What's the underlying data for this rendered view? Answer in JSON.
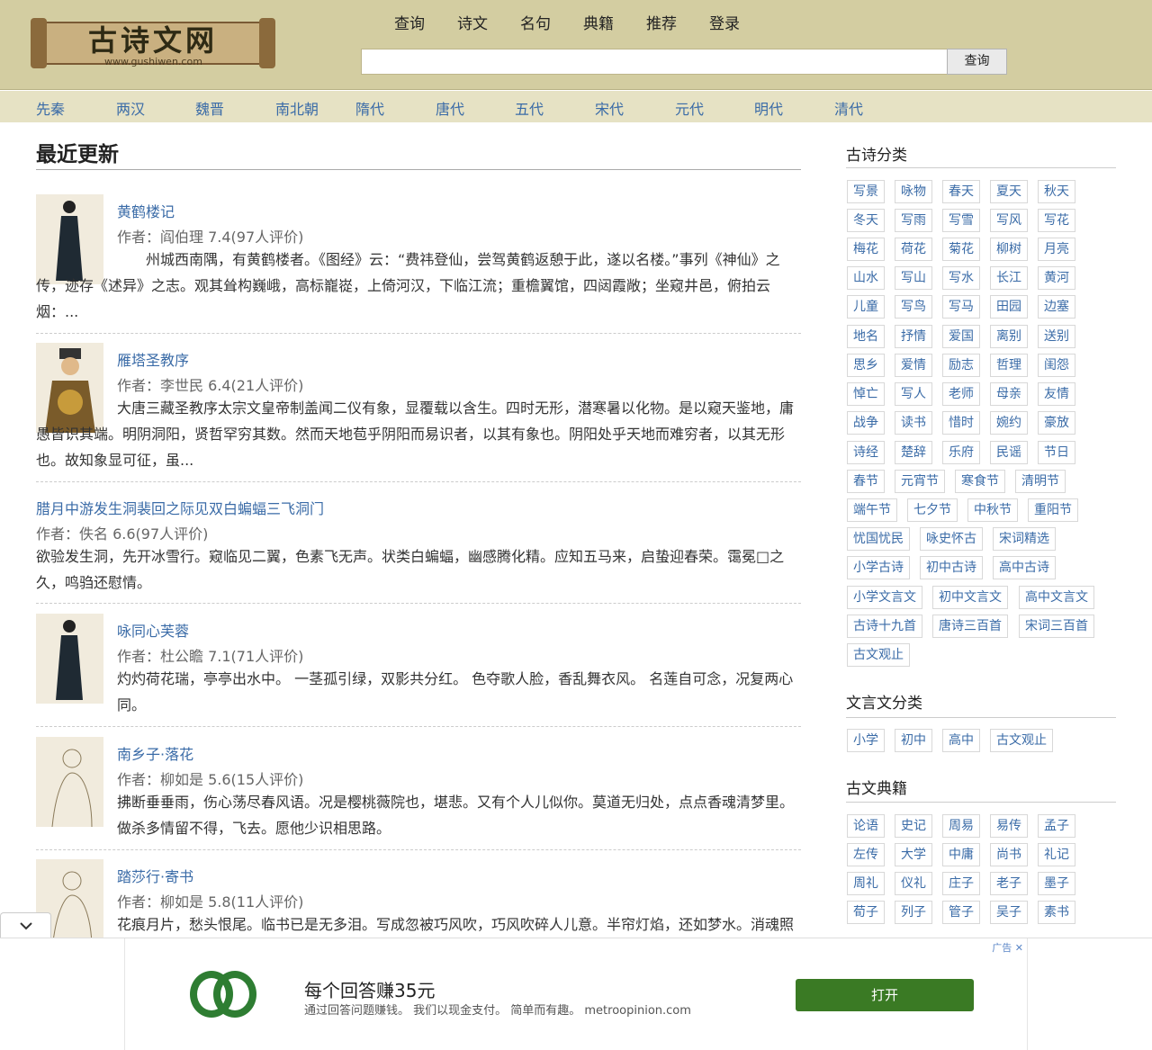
{
  "site": {
    "logo_text": "古诗文网",
    "logo_url_text": "www.gushiwen.com"
  },
  "nav": [
    "查询",
    "诗文",
    "名句",
    "典籍",
    "推荐",
    "登录"
  ],
  "search": {
    "placeholder": "",
    "button": "查询"
  },
  "dynasties": [
    "先秦",
    "两汉",
    "魏晋",
    "南北朝",
    "隋代",
    "唐代",
    "五代",
    "宋代",
    "元代",
    "明代",
    "清代"
  ],
  "main": {
    "title": "最近更新",
    "poems": [
      {
        "title": "黄鹤楼记",
        "author": "作者：阎伯理 7.4(97人评价)",
        "excerpt": "　　州城西南隅，有黄鹤楼者。《图经》云：“费祎登仙，尝驾黄鹤返憩于此，遂以名楼。”事列《神仙》之传，迹存《述异》之志。观其耸构巍峨，高标巃嵸，上倚河汉，下临江流；重檐翼馆，四闼霞敞；坐窥井邑，俯拍云烟：..."
      },
      {
        "title": "雁塔圣教序",
        "author": "作者：李世民 6.4(21人评价)",
        "excerpt": " 大唐三藏圣教序太宗文皇帝制盖闻二仪有象，显覆载以含生。四时无形，潜寒暑以化物。是以窥天鉴地，庸愚皆识其端。明阴洞阳，贤哲罕穷其数。然而天地苞乎阴阳而易识者，以其有象也。阴阳处乎天地而难穷者，以其无形也。故知象显可征，虽..."
      },
      {
        "title": "腊月中游发生洞裴回之际见双白蝙蝠三飞洞门",
        "author": "作者：佚名 6.6(97人评价)",
        "excerpt": "欲验发生洞，先开冰雪行。窥临见二翼，色素飞无声。状类白蝙蝠，幽感腾化精。应知五马来，启蛰迎春荣。霭冕□之久，鸣驺还慰情。"
      },
      {
        "title": "咏同心芙蓉",
        "author": "作者：杜公瞻 7.1(71人评价)",
        "excerpt": "灼灼荷花瑞，亭亭出水中。 一茎孤引绿，双影共分红。 色夺歌人脸，香乱舞衣风。 名莲自可念，况复两心同。"
      },
      {
        "title": "南乡子·落花",
        "author": "作者：柳如是 5.6(15人评价)",
        "excerpt": "拂断垂垂雨，伤心荡尽春风语。况是樱桃薇院也，堪悲。又有个人儿似你。莫道无归处，点点香魂清梦里。做杀多情留不得，飞去。愿他少识相思路。"
      },
      {
        "title": "踏莎行·寄书",
        "author": "作者：柳如是 5.8(11人评价)",
        "excerpt": "花痕月片，愁头恨尾。临书已是无多泪。写成忽被巧风吹，巧风吹碎人儿意。半帘灯焰，还如梦水。消魂照"
      }
    ]
  },
  "sidebar": {
    "poem_categories_title": "古诗分类",
    "poem_categories": [
      "写景",
      "咏物",
      "春天",
      "夏天",
      "秋天",
      "冬天",
      "写雨",
      "写雪",
      "写风",
      "写花",
      "梅花",
      "荷花",
      "菊花",
      "柳树",
      "月亮",
      "山水",
      "写山",
      "写水",
      "长江",
      "黄河",
      "儿童",
      "写鸟",
      "写马",
      "田园",
      "边塞",
      "地名",
      "抒情",
      "爱国",
      "离别",
      "送别",
      "思乡",
      "爱情",
      "励志",
      "哲理",
      "闺怨",
      "悼亡",
      "写人",
      "老师",
      "母亲",
      "友情",
      "战争",
      "读书",
      "惜时",
      "婉约",
      "豪放",
      "诗经",
      "楚辞",
      "乐府",
      "民谣",
      "节日",
      "春节",
      "元宵节",
      "寒食节",
      "清明节",
      "端午节",
      "七夕节",
      "中秋节",
      "重阳节",
      "忧国忧民",
      "咏史怀古",
      "宋词精选",
      "小学古诗",
      "初中古诗",
      "高中古诗",
      "小学文言文",
      "初中文言文",
      "高中文言文",
      "古诗十九首",
      "唐诗三百首",
      "宋词三百首",
      "古文观止"
    ],
    "prose_categories_title": "文言文分类",
    "prose_categories": [
      "小学",
      "初中",
      "高中",
      "古文观止"
    ],
    "classics_title": "古文典籍",
    "classics": [
      "论语",
      "史记",
      "周易",
      "易传",
      "孟子",
      "左传",
      "大学",
      "中庸",
      "尚书",
      "礼记",
      "周礼",
      "仪礼",
      "庄子",
      "老子",
      "墨子",
      "荀子",
      "列子",
      "管子",
      "吴子",
      "素书"
    ]
  },
  "collapse_icon": "chevron-down-icon",
  "ad": {
    "headline": "每个回答赚35元",
    "body": "通过回答问题赚钱。 我们以现金支付。 简单而有趣。 metroopinion.com",
    "button": "打开",
    "label": "广告 ✕"
  },
  "colors": {
    "header_bg": "#d3cda1",
    "dynasty_bg": "#e6e2c4",
    "link": "#3a6ba7",
    "ad_button": "#3a7a24"
  }
}
